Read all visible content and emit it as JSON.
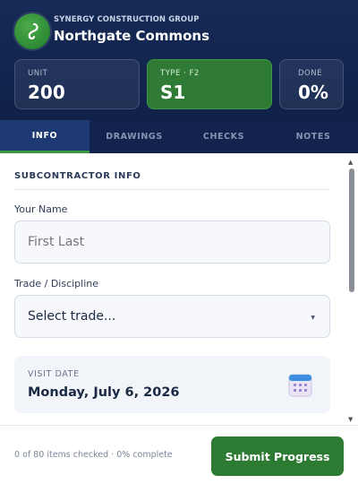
{
  "header": {
    "brand": "SYNERGY CONSTRUCTION GROUP",
    "project": "Northgate Commons",
    "logo_icon": "hook-icon",
    "stats": {
      "unit": {
        "label": "UNIT",
        "value": "200"
      },
      "type": {
        "label": "TYPE · F2",
        "value": "S1"
      },
      "done": {
        "label": "DONE",
        "value": "0%"
      }
    }
  },
  "tabs": [
    {
      "label": "INFO",
      "active": true
    },
    {
      "label": "DRAWINGS",
      "active": false
    },
    {
      "label": "CHECKS",
      "active": false
    },
    {
      "label": "NOTES",
      "active": false
    }
  ],
  "info": {
    "section_title": "SUBCONTRACTOR INFO",
    "name": {
      "label": "Your Name",
      "placeholder": "First Last"
    },
    "trade": {
      "label": "Trade / Discipline",
      "value": "Select trade..."
    },
    "visit": {
      "label": "VISIT DATE",
      "value": "Monday, July 6, 2026",
      "icon": "calendar-icon"
    }
  },
  "footer": {
    "status": "0 of 80 items checked · 0% complete",
    "submit_label": "Submit Progress"
  },
  "colors": {
    "header_bg": "#12244d",
    "accent_green": "#2d7a33",
    "active_tab": "#1d3a72"
  }
}
